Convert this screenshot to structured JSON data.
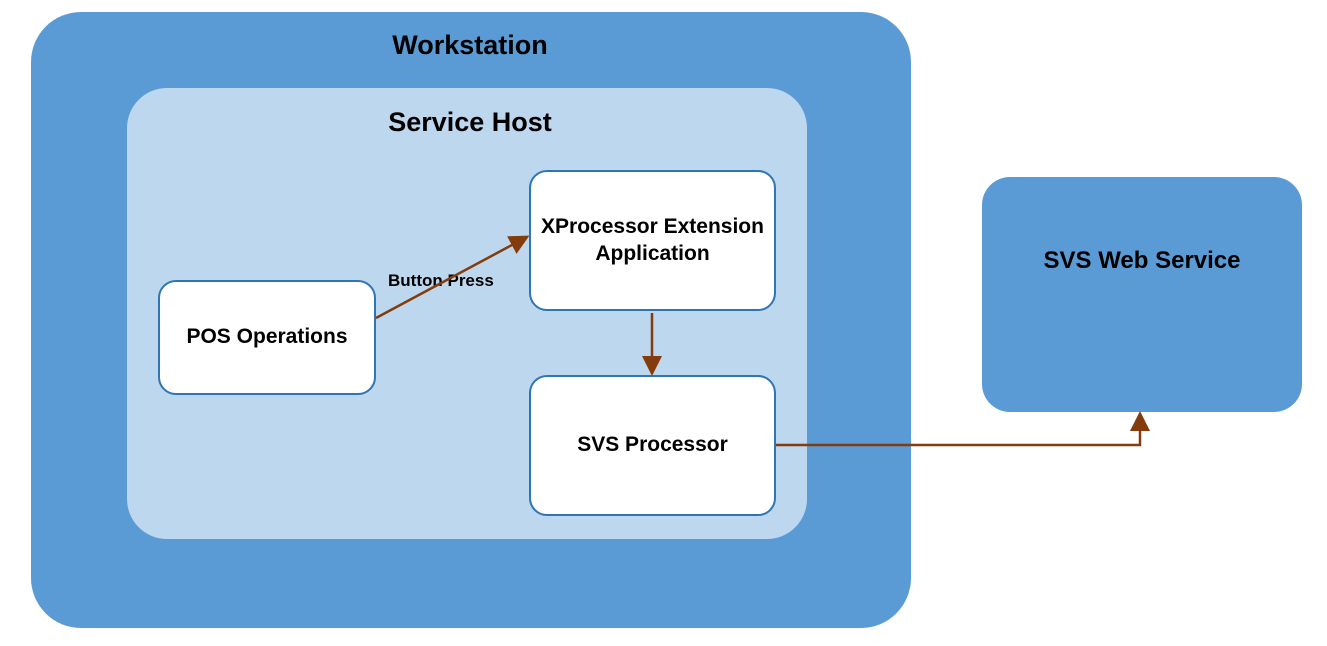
{
  "workstation": {
    "title": "Workstation"
  },
  "service_host": {
    "title": "Service Host"
  },
  "nodes": {
    "pos_operations": "POS Operations",
    "xprocessor": "XProcessor Extension Application",
    "svs_processor": "SVS Processor",
    "svs_web_service": "SVS Web Service"
  },
  "edges": {
    "button_press": "Button Press"
  }
}
